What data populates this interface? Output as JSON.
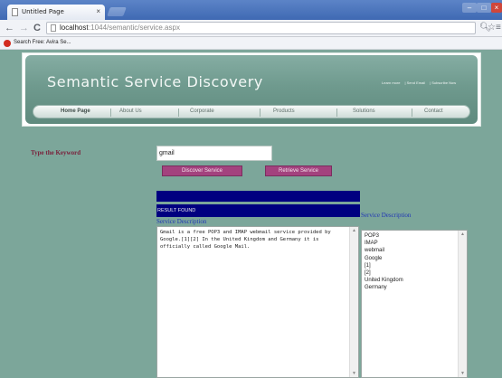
{
  "browser": {
    "tab_title": "Untitled Page",
    "tab_close": "×",
    "window_controls": {
      "minimize": "–",
      "maximize": "□",
      "close": "×"
    },
    "nav": {
      "back": "←",
      "forward": "→",
      "reload": "C"
    },
    "url_host": "localhost",
    "url_path": ":1044/semantic/service.aspx",
    "toolbar_icons": {
      "zoom": "zoom-icon",
      "star": "star-icon",
      "menu": "menu-icon"
    },
    "bookmark_label": "Search Free: Avira Se..."
  },
  "site": {
    "title": "Semantic Service Discovery",
    "top_links": [
      "Learn more",
      "Send Email",
      "Subscribe Now"
    ],
    "nav_items": [
      "Home Page",
      "About Us",
      "Corporate",
      "Products",
      "Solutions",
      "Contact"
    ]
  },
  "form": {
    "keyword_label": "Type the Keyword",
    "keyword_value": "gmail",
    "discover_button": "Discover Service",
    "retrieve_button": "Retrieve Service"
  },
  "results": {
    "status": "RESULT FOUND",
    "left_heading": "Service Description",
    "right_heading": "Service Description",
    "description": "Gmail is a free POP3 and IMAP webmail service provided by Google.[1][2] In the United Kingdom and Germany it is officially called Google Mail.",
    "terms": [
      "POP3",
      "IMAP",
      "webmail",
      "Google",
      "[1]",
      "[2]",
      "United Kingdom",
      "Germany"
    ]
  },
  "colors": {
    "page_bg": "#7ca69a",
    "button_bg": "#a3427e",
    "result_bar": "#000080",
    "label_maroon": "#7a1f3a",
    "heading_blue": "#2035b5"
  }
}
